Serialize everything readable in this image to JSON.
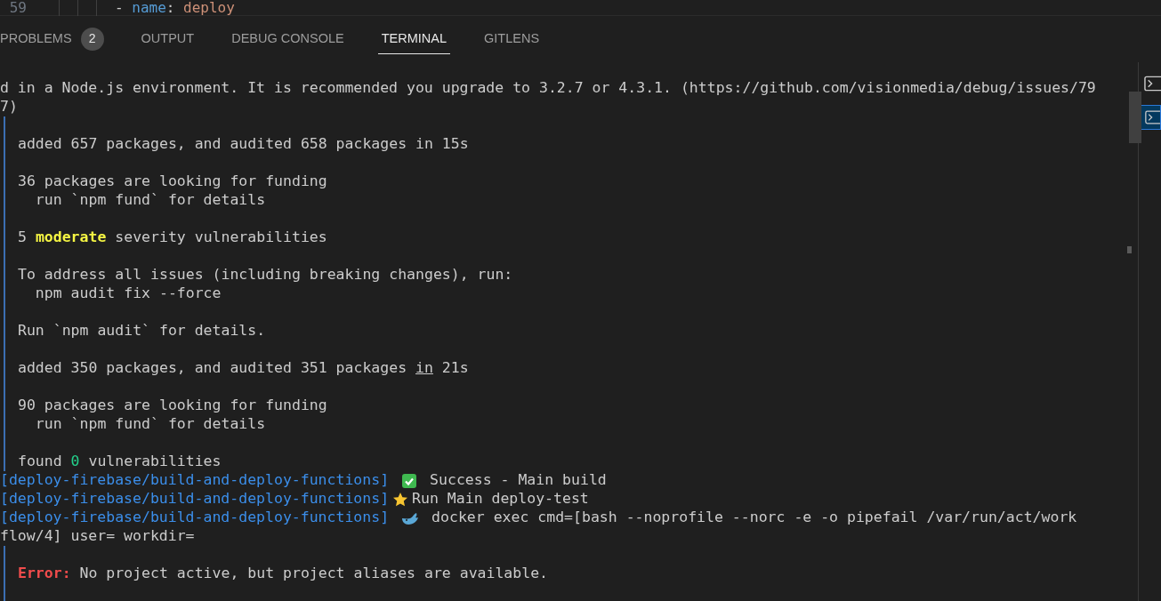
{
  "editor": {
    "line_number": "59",
    "code": [
      {
        "text": "- ",
        "kind": "plain"
      },
      {
        "text": "name",
        "kind": "key"
      },
      {
        "text": ": ",
        "kind": "plain"
      },
      {
        "text": "deploy",
        "kind": "string"
      }
    ]
  },
  "tabs": [
    {
      "label": "PROBLEMS",
      "badge": "2",
      "selected": false
    },
    {
      "label": "OUTPUT",
      "selected": false
    },
    {
      "label": "DEBUG CONSOLE",
      "selected": false
    },
    {
      "label": "TERMINAL",
      "selected": true
    },
    {
      "label": "GITLENS",
      "selected": false
    }
  ],
  "terminal_list": [
    {
      "selected": false
    },
    {
      "selected": true
    }
  ],
  "lines": [
    {
      "kind": "plain",
      "segments": [
        {
          "text": "d in a Node.js environment. It is recommended you upgrade to 3.2.7 or 4.3.1. (https://github.com/visionmedia/debug/issues/79",
          "kind": "plain"
        }
      ]
    },
    {
      "kind": "plain",
      "segments": [
        {
          "text": "7)",
          "kind": "plain"
        }
      ]
    },
    {
      "kind": "bar"
    },
    {
      "kind": "bar",
      "segments": [
        {
          "text": "added 657 packages, and audited 658 packages in 15s",
          "kind": "plain"
        }
      ]
    },
    {
      "kind": "bar"
    },
    {
      "kind": "bar",
      "segments": [
        {
          "text": "36 packages are looking for funding",
          "kind": "plain"
        }
      ]
    },
    {
      "kind": "bar",
      "segments": [
        {
          "text": "  run `npm fund` for details",
          "kind": "plain"
        }
      ]
    },
    {
      "kind": "bar"
    },
    {
      "kind": "bar",
      "segments": [
        {
          "text": "5 ",
          "kind": "plain"
        },
        {
          "text": "moderate",
          "kind": "warn"
        },
        {
          "text": " severity vulnerabilities",
          "kind": "plain"
        }
      ]
    },
    {
      "kind": "bar"
    },
    {
      "kind": "bar",
      "segments": [
        {
          "text": "To address all issues (including breaking changes), run:",
          "kind": "plain"
        }
      ]
    },
    {
      "kind": "bar",
      "segments": [
        {
          "text": "  npm audit fix --force",
          "kind": "plain"
        }
      ]
    },
    {
      "kind": "bar"
    },
    {
      "kind": "bar",
      "segments": [
        {
          "text": "Run `npm audit` for details.",
          "kind": "plain"
        }
      ]
    },
    {
      "kind": "bar"
    },
    {
      "kind": "bar",
      "segments": [
        {
          "text": "added 350 packages, and audited 351 packages ",
          "kind": "plain"
        },
        {
          "text": "in",
          "kind": "underline"
        },
        {
          "text": " 21s",
          "kind": "plain"
        }
      ]
    },
    {
      "kind": "bar"
    },
    {
      "kind": "bar",
      "segments": [
        {
          "text": "90 packages are looking for funding",
          "kind": "plain"
        }
      ]
    },
    {
      "kind": "bar",
      "segments": [
        {
          "text": "  run `npm fund` for details",
          "kind": "plain"
        }
      ]
    },
    {
      "kind": "bar"
    },
    {
      "kind": "bar",
      "segments": [
        {
          "text": "found ",
          "kind": "plain"
        },
        {
          "text": "0",
          "kind": "ok"
        },
        {
          "text": " vulnerabilities",
          "kind": "plain"
        }
      ]
    },
    {
      "kind": "plain",
      "segments": [
        {
          "text": "[deploy-firebase/build-and-deploy-functions]",
          "kind": "tag"
        },
        {
          "kind": "check"
        },
        {
          "text": "Success - Main build",
          "kind": "plain"
        }
      ]
    },
    {
      "kind": "plain",
      "segments": [
        {
          "text": "[deploy-firebase/build-and-deploy-functions]",
          "kind": "tag"
        },
        {
          "kind": "star"
        },
        {
          "text": "Run Main deploy-test",
          "kind": "plain"
        }
      ]
    },
    {
      "kind": "plain",
      "segments": [
        {
          "text": "[deploy-firebase/build-and-deploy-functions]",
          "kind": "tag"
        },
        {
          "kind": "whale"
        },
        {
          "text": "docker exec cmd=[bash --noprofile --norc -e -o pipefail /var/run/act/work",
          "kind": "plain"
        }
      ]
    },
    {
      "kind": "plain",
      "segments": [
        {
          "text": "flow/4] user= workdir=",
          "kind": "plain"
        }
      ]
    },
    {
      "kind": "bar"
    },
    {
      "kind": "bar",
      "segments": [
        {
          "text": "Error:",
          "kind": "error"
        },
        {
          "text": " No project active, but project aliases are available.",
          "kind": "plain"
        }
      ]
    },
    {
      "kind": "bar"
    }
  ]
}
